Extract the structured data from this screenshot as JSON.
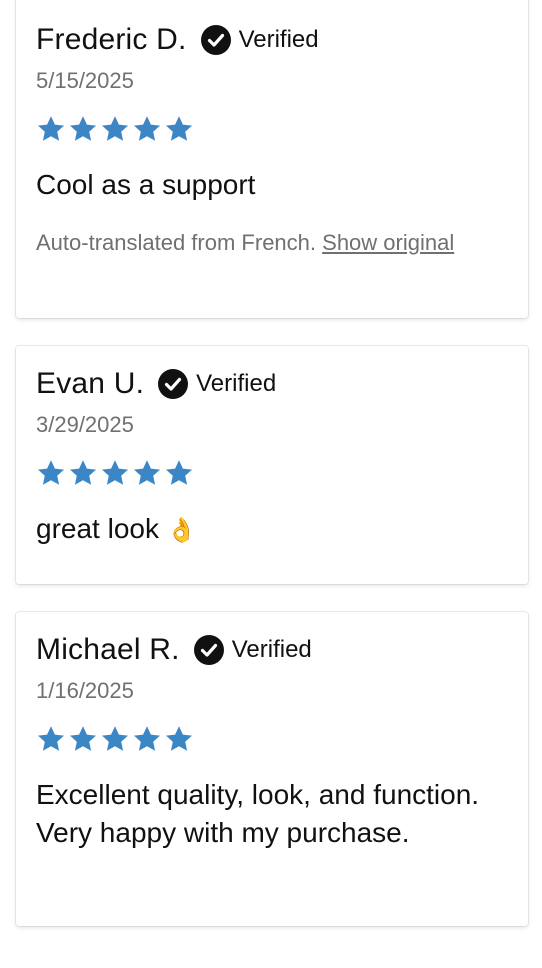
{
  "reviews": [
    {
      "name": "Frederic D.",
      "verified_label": "Verified",
      "date": "5/15/2025",
      "rating": 5,
      "text": "Cool as a support",
      "translation_note": "Auto-translated from French.",
      "show_original_label": "Show original"
    },
    {
      "name": "Evan U.",
      "verified_label": "Verified",
      "date": "3/29/2025",
      "rating": 5,
      "text": "great look",
      "emoji": "👌"
    },
    {
      "name": "Michael R.",
      "verified_label": "Verified",
      "date": "1/16/2025",
      "rating": 5,
      "text": "Excellent quality, look, and function.  Very happy with my purchase."
    }
  ],
  "colors": {
    "star": "#3d86c6",
    "verified_icon": "#111111",
    "muted_text": "#707070"
  },
  "icons": {
    "verified": "check-circle-icon",
    "star": "star-icon"
  }
}
